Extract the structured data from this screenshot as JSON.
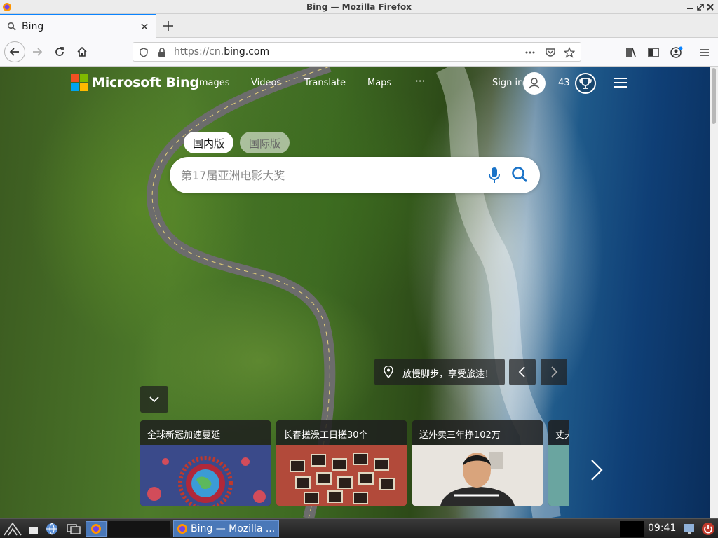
{
  "window": {
    "title": "Bing — Mozilla Firefox"
  },
  "tabs": [
    {
      "label": "Bing",
      "active": true
    }
  ],
  "navbar": {
    "url_prefix": "https://cn.",
    "url_domain": "bing.com"
  },
  "bing": {
    "logo_text": "Microsoft Bing",
    "nav": {
      "images": "Images",
      "videos": "Videos",
      "translate": "Translate",
      "maps": "Maps",
      "more": "···"
    },
    "sign_in": "Sign in",
    "points": "43",
    "region_tabs": {
      "domestic": "国内版",
      "international": "国际版"
    },
    "search": {
      "placeholder": "第17届亚洲电影大奖"
    },
    "caption": "放慢脚步，享受旅途！",
    "cards": [
      {
        "title": "全球新冠加速蔓延"
      },
      {
        "title": "长春搓澡工日搓30个"
      },
      {
        "title": "送外卖三年挣102万"
      },
      {
        "title": "丈夫"
      }
    ]
  },
  "taskbar": {
    "app_label": "Bing — Mozilla ...",
    "clock": "09:41"
  },
  "colors": {
    "ms_red": "#f25022",
    "ms_green": "#7fba00",
    "ms_blue": "#00a4ef",
    "ms_yellow": "#ffb900",
    "bing_blue": "#1a73c8",
    "firefox_accent": "#0a84ff"
  }
}
